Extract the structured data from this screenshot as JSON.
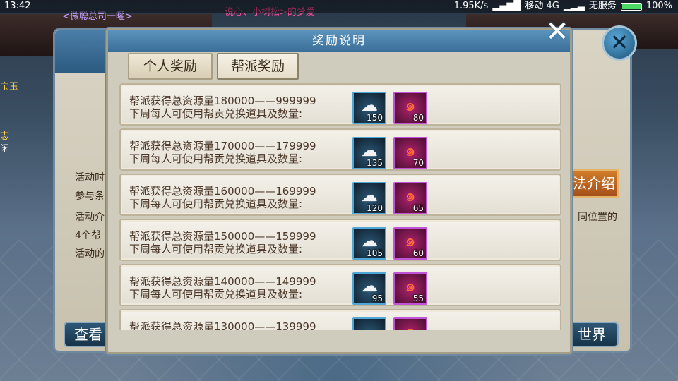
{
  "status_bar": {
    "time": "13:42",
    "speed": "1.95K/s",
    "carrier": "移动 4G",
    "service": "无服务",
    "battery": "100%"
  },
  "background": {
    "top_text_1": "<微聪总司一曜>",
    "top_text_2": "说心、小树松>的梦爱",
    "left_labels": [
      "宝玉",
      "志",
      "闲"
    ],
    "panel_text": [
      "活动时",
      "参与条",
      "活动介",
      "4个帮",
      "活动的"
    ],
    "right_text": "同位置的",
    "intro_button": "法介绍",
    "view_button": "查看",
    "world_button": "世界"
  },
  "dialog": {
    "title": "奖励说明",
    "close_icon": "close-icon",
    "tabs": [
      {
        "label": "个人奖励",
        "active": false
      },
      {
        "label": "帮派奖励",
        "active": true
      }
    ],
    "rows": [
      {
        "range": "帮派获得总资源量180000——999999",
        "desc": "下周每人可使用帮贡兑换道具及数量:",
        "item1_qty": "150",
        "item2_qty": "80"
      },
      {
        "range": "帮派获得总资源量170000——179999",
        "desc": "下周每人可使用帮贡兑换道具及数量:",
        "item1_qty": "135",
        "item2_qty": "70"
      },
      {
        "range": "帮派获得总资源量160000——169999",
        "desc": "下周每人可使用帮贡兑换道具及数量:",
        "item1_qty": "120",
        "item2_qty": "65"
      },
      {
        "range": "帮派获得总资源量150000——159999",
        "desc": "下周每人可使用帮贡兑换道具及数量:",
        "item1_qty": "105",
        "item2_qty": "60"
      },
      {
        "range": "帮派获得总资源量140000——149999",
        "desc": "下周每人可使用帮贡兑换道具及数量:",
        "item1_qty": "95",
        "item2_qty": "55"
      },
      {
        "range": "帮派获得总资源量130000——139999",
        "desc": "",
        "item1_qty": "",
        "item2_qty": ""
      }
    ],
    "item_icons": [
      "cloud-item-icon",
      "fire-swirl-item-icon"
    ]
  }
}
